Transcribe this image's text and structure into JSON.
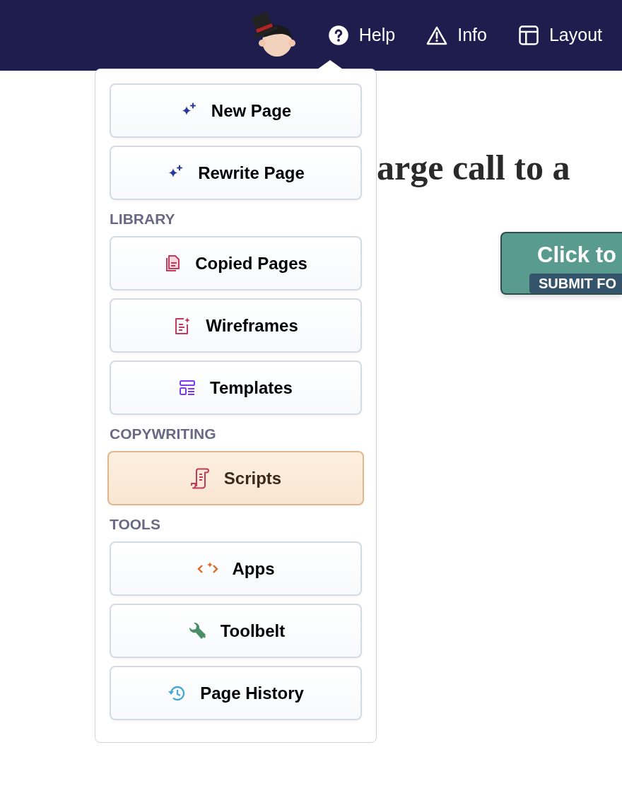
{
  "navbar": {
    "links": [
      {
        "label": "Help"
      },
      {
        "label": "Info"
      },
      {
        "label": "Layout"
      }
    ]
  },
  "menu": {
    "sections": [
      {
        "items": [
          {
            "label": "New Page",
            "selected": false
          },
          {
            "label": "Rewrite Page",
            "selected": false
          }
        ]
      },
      {
        "heading": "LIBRARY",
        "items": [
          {
            "label": "Copied Pages",
            "selected": false
          },
          {
            "label": "Wireframes",
            "selected": false
          },
          {
            "label": "Templates",
            "selected": false
          }
        ]
      },
      {
        "heading": "COPYWRITING",
        "items": [
          {
            "label": "Scripts",
            "selected": true
          }
        ]
      },
      {
        "heading": "TOOLS",
        "items": [
          {
            "label": "Apps",
            "selected": false
          },
          {
            "label": "Toolbelt",
            "selected": false
          },
          {
            "label": "Page History",
            "selected": false
          }
        ]
      }
    ]
  },
  "main": {
    "headline": "arge call to a",
    "cta": {
      "label": "Click to",
      "badge": "SUBMIT FO"
    }
  }
}
